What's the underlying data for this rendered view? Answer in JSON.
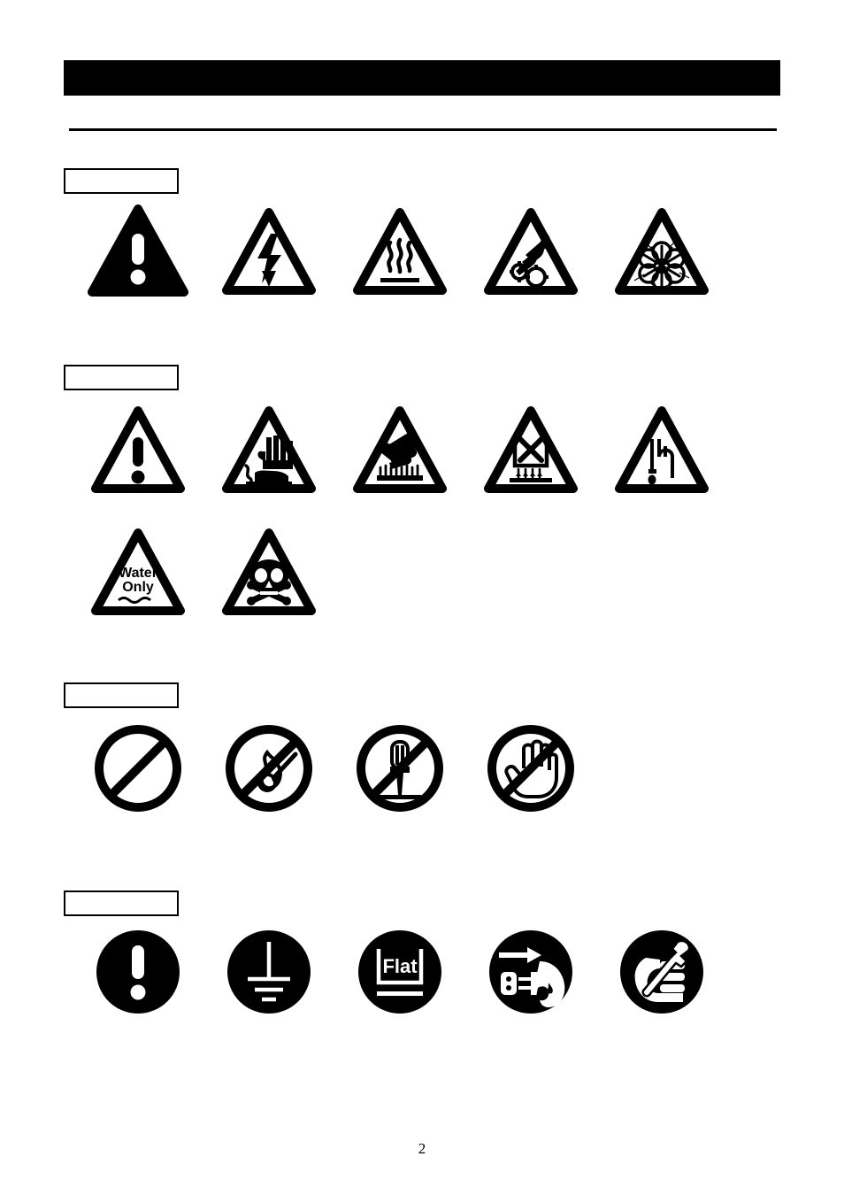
{
  "document": {
    "page_number": "2",
    "header_bar_text": "",
    "header_bar_color": "#000000",
    "background_color": "#ffffff",
    "ink_color": "#000000"
  },
  "sections": [
    {
      "id": "warning-hazard-symbols",
      "label": "",
      "rows": [
        {
          "icons": [
            {
              "name": "warning-triangle-solid-icon",
              "shape": "triangle-solid",
              "meaning": "General warning",
              "text": ""
            },
            {
              "name": "electric-shock-triangle-icon",
              "shape": "triangle-outline",
              "meaning": "Electric shock hazard",
              "text": ""
            },
            {
              "name": "hot-surface-triangle-icon",
              "shape": "triangle-outline",
              "meaning": "Hot surface",
              "text": ""
            },
            {
              "name": "hand-crush-gears-triangle-icon",
              "shape": "triangle-outline",
              "meaning": "Hand entanglement in gears",
              "text": ""
            },
            {
              "name": "explosion-burst-triangle-icon",
              "shape": "triangle-outline",
              "meaning": "Explosion hazard",
              "text": ""
            }
          ]
        }
      ]
    },
    {
      "id": "caution-hazard-symbols",
      "label": "",
      "rows": [
        {
          "icons": [
            {
              "name": "caution-triangle-outline-icon",
              "shape": "triangle-outline",
              "meaning": "General caution",
              "text": ""
            },
            {
              "name": "corrosive-hand-triangle-icon",
              "shape": "triangle-outline",
              "meaning": "Corrosive to hands",
              "text": ""
            },
            {
              "name": "hot-plate-burn-hand-triangle-icon",
              "shape": "triangle-outline",
              "meaning": "Burn hazard from heated surface",
              "text": ""
            },
            {
              "name": "no-heating-empty-vessel-triangle-icon",
              "shape": "triangle-outline",
              "meaning": "Do not heat empty vessel",
              "text": ""
            },
            {
              "name": "drain-tube-drip-triangle-icon",
              "shape": "triangle-outline",
              "meaning": "Liquid drain / drip hazard",
              "text": ""
            }
          ]
        },
        {
          "icons": [
            {
              "name": "water-only-triangle-icon",
              "shape": "triangle-outline",
              "meaning": "Use water only",
              "text": "Water\nOnly"
            },
            {
              "name": "toxic-skull-crossbones-triangle-icon",
              "shape": "triangle-outline",
              "meaning": "Toxic substance",
              "text": ""
            }
          ]
        }
      ]
    },
    {
      "id": "prohibition-symbols",
      "label": "",
      "rows": [
        {
          "icons": [
            {
              "name": "general-prohibition-icon",
              "shape": "circle-slash",
              "meaning": "General prohibition",
              "text": ""
            },
            {
              "name": "no-open-flame-icon",
              "shape": "circle-slash",
              "meaning": "No open flame or matches",
              "text": ""
            },
            {
              "name": "no-disassembly-screwdriver-icon",
              "shape": "circle-slash",
              "meaning": "Do not disassemble",
              "text": ""
            },
            {
              "name": "do-not-touch-hand-icon",
              "shape": "circle-slash",
              "meaning": "Do not touch",
              "text": ""
            }
          ]
        }
      ]
    },
    {
      "id": "mandatory-action-symbols",
      "label": "",
      "rows": [
        {
          "icons": [
            {
              "name": "mandatory-action-exclamation-icon",
              "shape": "circle-solid",
              "meaning": "Mandatory action",
              "text": ""
            },
            {
              "name": "protective-earth-ground-icon",
              "shape": "circle-solid",
              "meaning": "Connect protective earth ground",
              "text": ""
            },
            {
              "name": "place-on-flat-surface-icon",
              "shape": "circle-solid",
              "meaning": "Place on flat surface",
              "text": "Flat"
            },
            {
              "name": "unplug-from-mains-icon",
              "shape": "circle-solid",
              "meaning": "Disconnect mains plug",
              "text": ""
            },
            {
              "name": "use-tool-wrench-hand-icon",
              "shape": "circle-solid",
              "meaning": "Use correct tool / service required",
              "text": ""
            }
          ]
        }
      ]
    }
  ]
}
